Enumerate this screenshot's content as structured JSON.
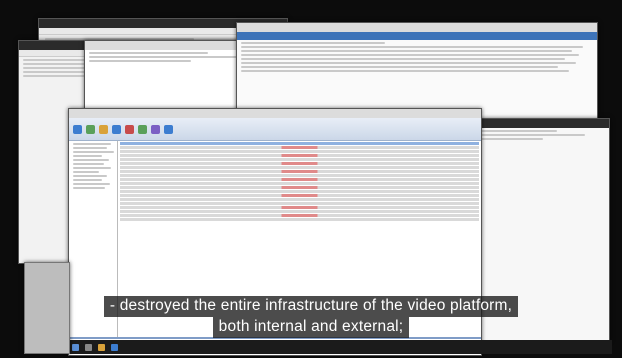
{
  "subtitle": {
    "line1": "- destroyed the entire infrastructure of the video platform,",
    "line2": "both internal and external;"
  },
  "colors": {
    "subtitle_background": "#191919",
    "ribbon": "#cbd7e8",
    "selection": "#8fb1e0",
    "error_rows": "#e08a8a"
  }
}
